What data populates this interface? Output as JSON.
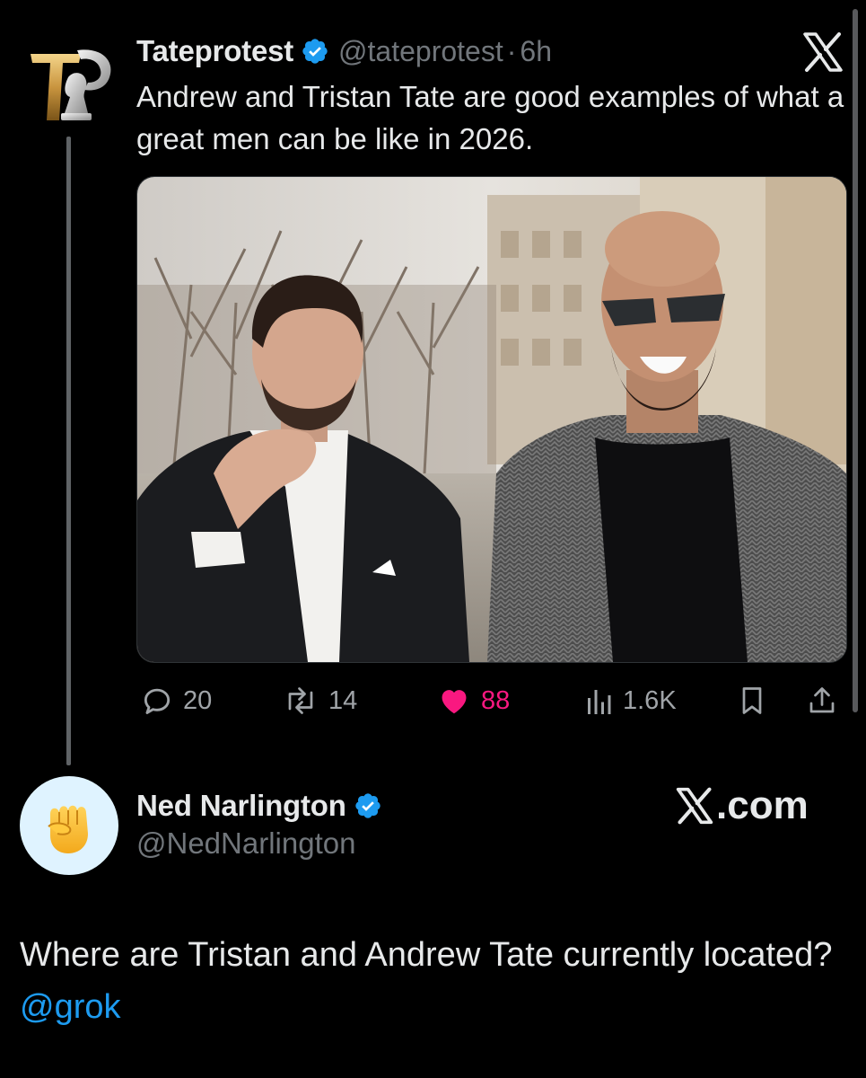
{
  "tweet": {
    "avatar_icon": "tateprotest-logo",
    "author_name": "Tateprotest",
    "verified_icon": "verified-badge-icon",
    "handle": "@tateprotest",
    "separator": "·",
    "time": "6h",
    "text": "Andrew and Tristan Tate are good examples of what a great men can be like in 2026.",
    "photo_icon": "photo-two-men-walking",
    "close_icon": "x-logo-icon",
    "actions": {
      "replies": "20",
      "reposts": "14",
      "likes": "88",
      "views": "1.6K"
    }
  },
  "reply": {
    "avatar_icon": "raised-fist-emoji",
    "author_name": "Ned Narlington",
    "handle": "@NedNarlington",
    "brand": ".com",
    "text_before": "Where are Tristan and Andrew Tate currently located?",
    "mention": "@grok"
  },
  "colors": {
    "background": "#000000",
    "text": "#e7e9ea",
    "muted": "#71767b",
    "like": "#f91880",
    "link": "#1d9bf0",
    "verified": "#1d9bf0"
  }
}
